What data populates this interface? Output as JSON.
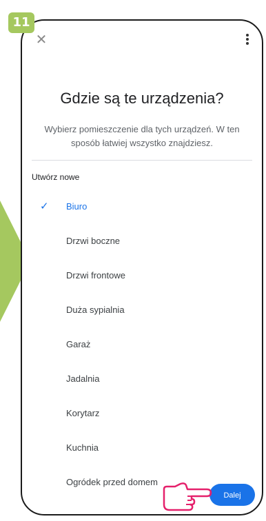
{
  "step_badge": "11",
  "header": {
    "close_icon": "close-icon",
    "more_icon": "more-vert-icon"
  },
  "title": "Gdzie są te urządzenia?",
  "subtitle": "Wybierz pomieszczenie dla tych urządzeń. W ten sposób łatwiej wszystko znajdziesz.",
  "section_label": "Utwórz nowe",
  "rooms": [
    {
      "label": "Biuro",
      "selected": true
    },
    {
      "label": "Drzwi boczne",
      "selected": false
    },
    {
      "label": "Drzwi frontowe",
      "selected": false
    },
    {
      "label": "Duża sypialnia",
      "selected": false
    },
    {
      "label": "Garaż",
      "selected": false
    },
    {
      "label": "Jadalnia",
      "selected": false
    },
    {
      "label": "Korytarz",
      "selected": false
    },
    {
      "label": "Kuchnia",
      "selected": false
    },
    {
      "label": "Ogródek przed domem",
      "selected": false
    }
  ],
  "next_button": "Dalej",
  "colors": {
    "accent": "#1a73e8",
    "badge": "#a5c85f",
    "hand": "#e5206b"
  }
}
